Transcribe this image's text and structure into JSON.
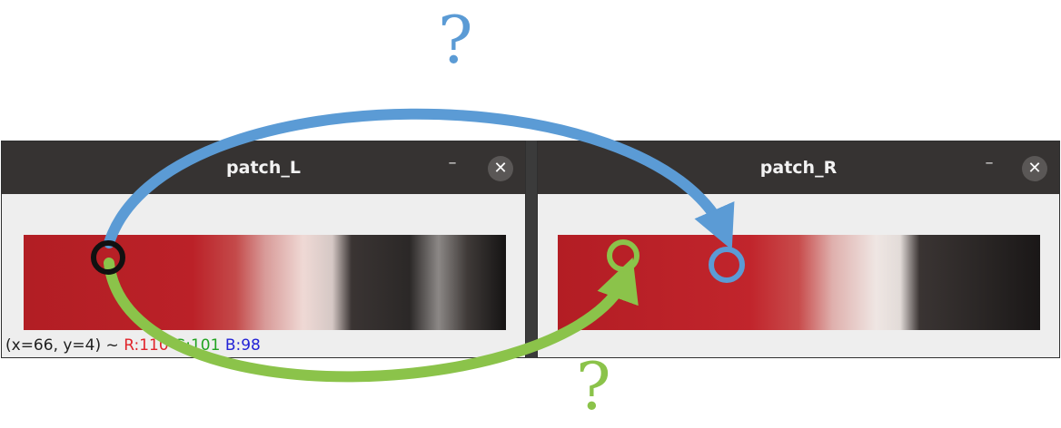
{
  "windows": {
    "left": {
      "title": "patch_L",
      "minimize_glyph": "–",
      "close_glyph": "✕"
    },
    "right": {
      "title": "patch_R",
      "minimize_glyph": "–",
      "close_glyph": "✕"
    }
  },
  "status_bar": {
    "coords": "(x=66, y=4) ~",
    "r": "R:110",
    "g": "G:101",
    "b": "B:98"
  },
  "annotations": {
    "question_top": "?",
    "question_bottom": "?",
    "colors": {
      "blue": "#5b9bd5",
      "green": "#8bc34a",
      "black": "#111111"
    }
  }
}
